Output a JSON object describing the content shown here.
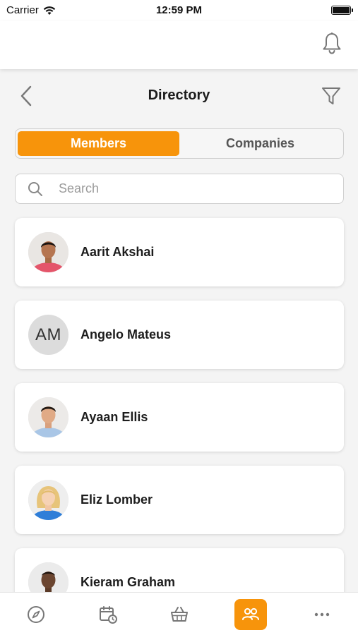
{
  "status_bar": {
    "carrier": "Carrier",
    "time": "12:59 PM"
  },
  "header": {
    "title": "Directory",
    "icons": [
      "bell-icon",
      "back-icon",
      "filter-icon"
    ]
  },
  "segments": {
    "members": "Members",
    "companies": "Companies",
    "active": "Members"
  },
  "search": {
    "placeholder": "Search",
    "value": ""
  },
  "members": [
    {
      "name": "Aarit Akshai",
      "avatar": "photo"
    },
    {
      "name": "Angelo Mateus",
      "avatar": "initials",
      "initials": "AM"
    },
    {
      "name": "Ayaan Ellis",
      "avatar": "photo"
    },
    {
      "name": "Eliz Lomber",
      "avatar": "photo"
    },
    {
      "name": "Kieram Graham",
      "avatar": "photo"
    }
  ],
  "tab_bar": {
    "items": [
      "compass-icon",
      "calendar-clock-icon",
      "basket-icon",
      "people-icon",
      "more-icon"
    ],
    "active": "people-icon"
  },
  "colors": {
    "accent": "#f7940b",
    "background": "#f4f4f4",
    "card": "#ffffff"
  }
}
